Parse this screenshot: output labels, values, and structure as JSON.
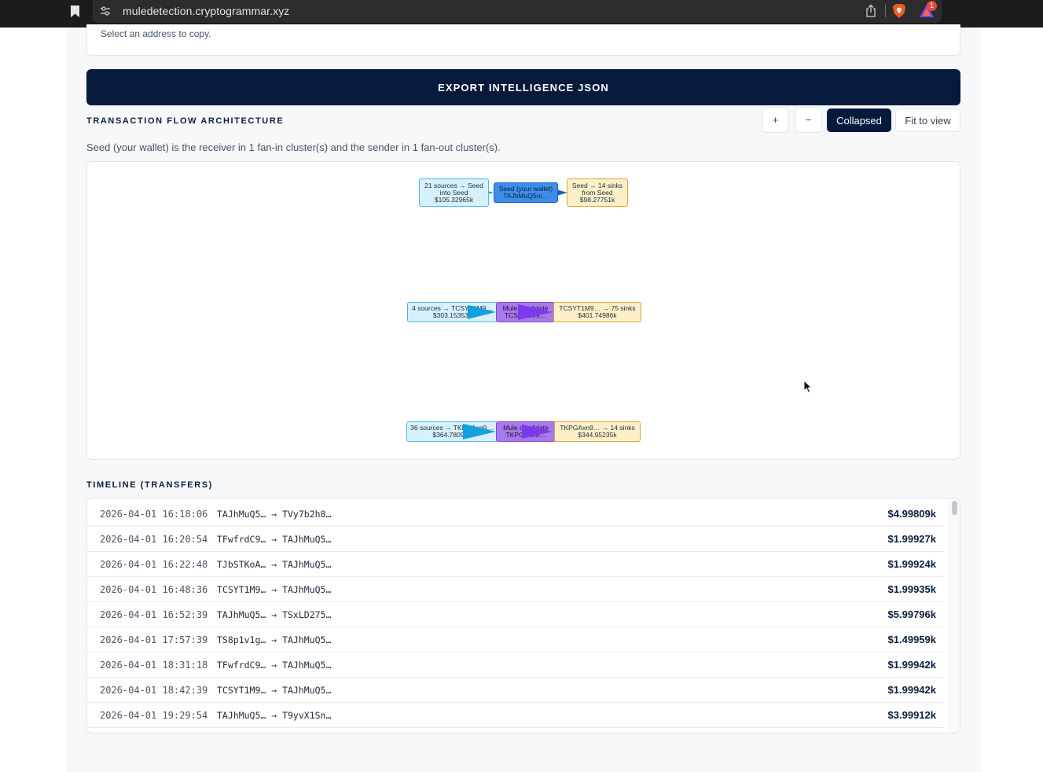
{
  "browser": {
    "url": "muledetection.cryptogrammar.xyz",
    "notification_count": "1"
  },
  "copy_hint": "Select an address to copy.",
  "export_button": "EXPORT INTELLIGENCE JSON",
  "flow": {
    "title": "TRANSACTION FLOW ARCHITECTURE",
    "controls": {
      "zoom_in": "+",
      "zoom_out": "−",
      "collapsed": "Collapsed",
      "fit": "Fit to view"
    },
    "summary": "Seed (your wallet) is the receiver in 1 fan-in cluster(s) and the sender in 1 fan-out cluster(s).",
    "clusters": [
      {
        "source": [
          "21 sources → Seed",
          "into Seed",
          "$105.32965k"
        ],
        "center": [
          "Seed (your wallet)",
          "TAJhMuQ5ni…"
        ],
        "sink": [
          "Seed → 14 sinks",
          "from Seed",
          "$98.27751k"
        ]
      },
      {
        "source": [
          "4 sources → TCSYT1M9…",
          "$303.15353k"
        ],
        "center": [
          "Mule candidate",
          "TCSYT1M9…"
        ],
        "sink": [
          "TCSYT1M9… → 75 sinks",
          "$401.74986k"
        ]
      },
      {
        "source": [
          "36 sources → TKPGAxn9…",
          "$364.78098k"
        ],
        "center": [
          "Mule candidate",
          "TKPGAxn9…"
        ],
        "sink": [
          "TKPGAxn9… → 14 sinks",
          "$344.95235k"
        ]
      }
    ],
    "colors": {
      "source_fill": "#d6f1fb",
      "source_edge": "#17a2e0",
      "seed_fill": "#3e8ee9",
      "mule_fill": "#a779ea",
      "mule_edge": "#7c3aed",
      "sink_fill": "#fdf0c9"
    }
  },
  "timeline": {
    "title": "TIMELINE (TRANSFERS)",
    "rows": [
      {
        "time": "2026-04-01 16:18:06",
        "route": "TAJhMuQ5… → TVy7b2h8…",
        "amount": "$4.99809k"
      },
      {
        "time": "2026-04-01 16:20:54",
        "route": "TFwfrdC9… → TAJhMuQ5…",
        "amount": "$1.99927k"
      },
      {
        "time": "2026-04-01 16:22:48",
        "route": "TJbSTKoA… → TAJhMuQ5…",
        "amount": "$1.99924k"
      },
      {
        "time": "2026-04-01 16:48:36",
        "route": "TCSYT1M9… → TAJhMuQ5…",
        "amount": "$1.99935k"
      },
      {
        "time": "2026-04-01 16:52:39",
        "route": "TAJhMuQ5… → TSxLD275…",
        "amount": "$5.99796k"
      },
      {
        "time": "2026-04-01 17:57:39",
        "route": "TS8p1v1g… → TAJhMuQ5…",
        "amount": "$1.49959k"
      },
      {
        "time": "2026-04-01 18:31:18",
        "route": "TFwfrdC9… → TAJhMuQ5…",
        "amount": "$1.99942k"
      },
      {
        "time": "2026-04-01 18:42:39",
        "route": "TCSYT1M9… → TAJhMuQ5…",
        "amount": "$1.99942k"
      },
      {
        "time": "2026-04-01 19:29:54",
        "route": "TAJhMuQ5… → T9yvX1Sn…",
        "amount": "$3.99912k"
      }
    ]
  },
  "icons": {
    "bookmark": "bookmark-icon",
    "site_settings": "tune-icon",
    "share": "share-icon",
    "brave": "brave-shield-icon",
    "rewards": "brave-rewards-icon",
    "cursor": "mouse-cursor-icon"
  }
}
